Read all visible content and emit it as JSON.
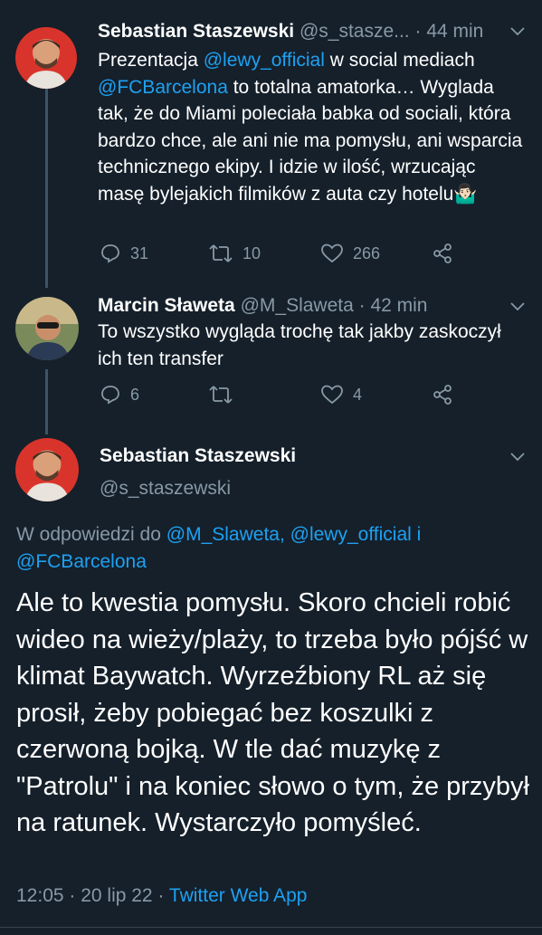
{
  "tweet1": {
    "name": "Sebastian Staszewski",
    "handle": "@s_stasze...",
    "time": "44 min",
    "body_parts": [
      {
        "text": "Prezentacja ",
        "mention": false
      },
      {
        "text": "@lewy_official",
        "mention": true
      },
      {
        "text": " w social mediach ",
        "mention": false
      },
      {
        "text": "@FCBarcelona",
        "mention": true
      },
      {
        "text": " to totalna amatorka… Wyglada tak, że do Miami poleciała babka od sociali, która bardzo chce, ale ani nie ma pomysłu, ani wsparcia technicznego ekipy. I idzie w ilość, wrzucając masę bylejakich filmików z auta czy hotelu🤷🏻‍♂️",
        "mention": false
      }
    ],
    "replies": "31",
    "retweets": "10",
    "likes": "266"
  },
  "tweet2": {
    "name": "Marcin Sławeta",
    "handle": "@M_Slaweta",
    "time": "42 min",
    "body": "To wszystko wygląda trochę tak jakby zaskoczył ich ten transfer",
    "replies": "6",
    "retweets": "",
    "likes": "4"
  },
  "main": {
    "name": "Sebastian Staszewski",
    "handle": "@s_staszewski",
    "reply_prefix": "W odpowiedzi do ",
    "reply_mentions": "@M_Slaweta, @lewy_official i @FCBarcelona",
    "body": "Ale to kwestia pomysłu. Skoro chcieli robić wideo na wieży/plaży, to trzeba było pójść w klimat Baywatch. Wyrzeźbiony RL aż się prosił, żeby pobiegać bez koszulki z czerwoną bojką. W tle dać muzykę z \"Patrolu\" i na koniec słowo o tym, że przybył na ratunek. Wystarczyło pomyśleć.",
    "time": "12:05 · 20 lip 22 · ",
    "source": "Twitter Web App"
  },
  "colors": {
    "background": "#15202b",
    "secondary_text": "#8899a6",
    "link": "#1da1f2",
    "thread_line": "#3d5466"
  },
  "icons": [
    "reply-icon",
    "retweet-icon",
    "like-icon",
    "share-icon",
    "chevron-down-icon"
  ]
}
